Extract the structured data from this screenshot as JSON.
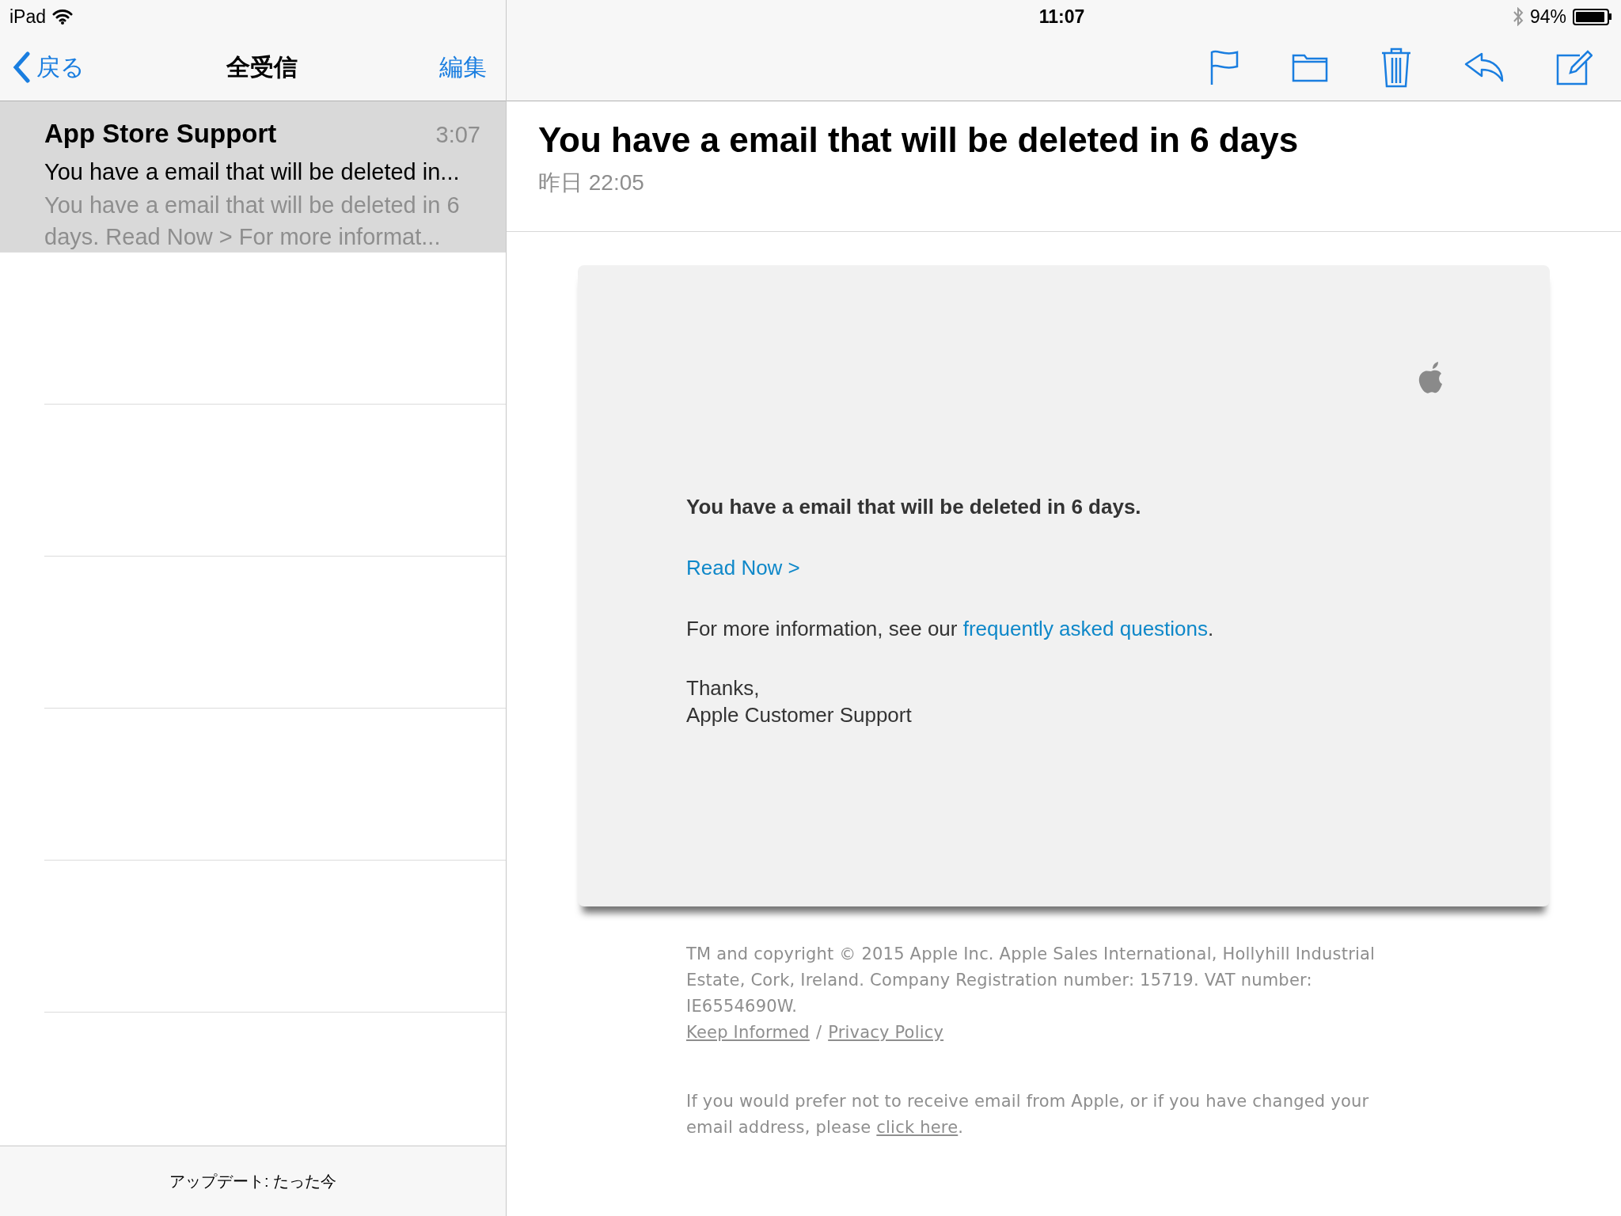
{
  "status_bar": {
    "carrier": "iPad",
    "time": "11:07",
    "battery_text": "94%"
  },
  "nav_bar": {
    "back": "戻る",
    "title": "全受信",
    "edit": "編集"
  },
  "messages": [
    {
      "sender": "App Store Support",
      "time": "3:07",
      "subject": "You have a email that will be deleted in...",
      "preview": "You have a email that will be deleted in 6 days. Read Now > For more informat...",
      "selected": true
    }
  ],
  "list_footer": "アップデート: たった今",
  "email": {
    "subject": "You have a email that will be deleted in 6 days",
    "date": "昨日 22:05",
    "heading": "You have a email that will be deleted in 6 days.",
    "read_link": "Read Now >",
    "info": {
      "text_before": "For more information, see our ",
      "link": "frequently asked questions",
      "text_after": "."
    },
    "closing": [
      "Thanks,",
      "Apple Customer Support"
    ],
    "legal": "TM and copyright © 2015 Apple Inc. Apple Sales International, Hollyhill Industrial Estate, Cork, Ireland. Company Registration number: 15719. VAT number: IE6554690W.",
    "legal_links": [
      "Keep Informed",
      "Privacy Policy"
    ],
    "legal_separator": "/",
    "unsubscribe": {
      "text_before": "If you would prefer not to receive email from Apple, or if you have changed your email address, please ",
      "link": "click here",
      "text_after": "."
    }
  }
}
